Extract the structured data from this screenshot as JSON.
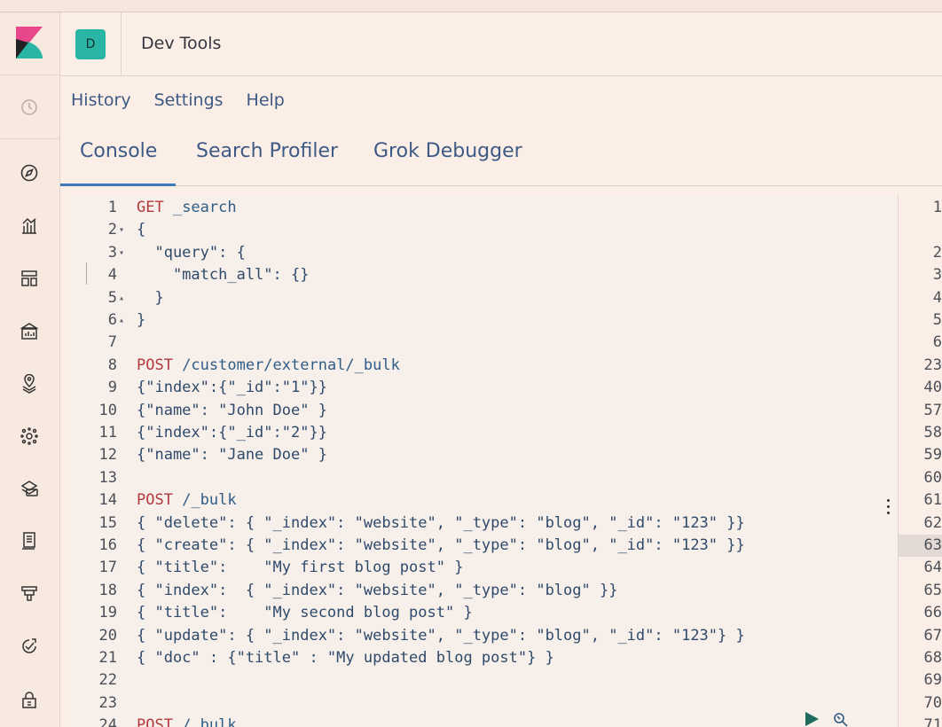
{
  "header": {
    "avatar_letter": "D",
    "title": "Dev Tools"
  },
  "nav_icons": [
    "clock-icon",
    "compass-icon",
    "visualize-icon",
    "dashboard-icon",
    "canvas-icon",
    "maps-icon",
    "ml-icon",
    "infrastructure-icon",
    "logs-icon",
    "apm-icon",
    "uptime-icon",
    "siem-icon"
  ],
  "menu": [
    "History",
    "Settings",
    "Help"
  ],
  "tabs": [
    "Console",
    "Search Profiler",
    "Grok Debugger"
  ],
  "editor": {
    "lines": [
      {
        "n": "1",
        "fold": "",
        "method": "GET",
        "rest": " _search"
      },
      {
        "n": "2",
        "fold": "▾",
        "method": "",
        "rest": "{"
      },
      {
        "n": "3",
        "fold": "▾",
        "method": "",
        "rest": "  \"query\": {"
      },
      {
        "n": "4",
        "fold": "",
        "method": "",
        "rest": "    \"match_all\": {}"
      },
      {
        "n": "5",
        "fold": "▴",
        "method": "",
        "rest": "  }"
      },
      {
        "n": "6",
        "fold": "▴",
        "method": "",
        "rest": "}"
      },
      {
        "n": "7",
        "fold": "",
        "method": "",
        "rest": ""
      },
      {
        "n": "8",
        "fold": "",
        "method": "POST",
        "rest": " /customer/external/_bulk"
      },
      {
        "n": "9",
        "fold": "",
        "method": "",
        "rest": "{\"index\":{\"_id\":\"1\"}}"
      },
      {
        "n": "10",
        "fold": "",
        "method": "",
        "rest": "{\"name\": \"John Doe\" }"
      },
      {
        "n": "11",
        "fold": "",
        "method": "",
        "rest": "{\"index\":{\"_id\":\"2\"}}"
      },
      {
        "n": "12",
        "fold": "",
        "method": "",
        "rest": "{\"name\": \"Jane Doe\" }"
      },
      {
        "n": "13",
        "fold": "",
        "method": "",
        "rest": ""
      },
      {
        "n": "14",
        "fold": "",
        "method": "POST",
        "rest": " /_bulk"
      },
      {
        "n": "15",
        "fold": "",
        "method": "",
        "rest": "{ \"delete\": { \"_index\": \"website\", \"_type\": \"blog\", \"_id\": \"123\" }}"
      },
      {
        "n": "16",
        "fold": "",
        "method": "",
        "rest": "{ \"create\": { \"_index\": \"website\", \"_type\": \"blog\", \"_id\": \"123\" }}"
      },
      {
        "n": "17",
        "fold": "",
        "method": "",
        "rest": "{ \"title\":    \"My first blog post\" }"
      },
      {
        "n": "18",
        "fold": "",
        "method": "",
        "rest": "{ \"index\":  { \"_index\": \"website\", \"_type\": \"blog\" }}"
      },
      {
        "n": "19",
        "fold": "",
        "method": "",
        "rest": "{ \"title\":    \"My second blog post\" }"
      },
      {
        "n": "20",
        "fold": "",
        "method": "",
        "rest": "{ \"update\": { \"_index\": \"website\", \"_type\": \"blog\", \"_id\": \"123\"} }"
      },
      {
        "n": "21",
        "fold": "",
        "method": "",
        "rest": "{ \"doc\" : {\"title\" : \"My updated blog post\"} }"
      },
      {
        "n": "22",
        "fold": "",
        "method": "",
        "rest": ""
      },
      {
        "n": "23",
        "fold": "",
        "method": "",
        "rest": ""
      },
      {
        "n": "24",
        "fold": "",
        "method": "POST",
        "rest": " /_bulk"
      }
    ]
  },
  "output_gutter": [
    "1",
    "",
    "2",
    "3",
    "4",
    "5",
    "6",
    "23",
    "40",
    "57",
    "58",
    "59",
    "60",
    "61",
    "62",
    "63",
    "64",
    "65",
    "66",
    "67",
    "68",
    "69",
    "70",
    "71"
  ],
  "colors": {
    "accent": "#3c7ab7",
    "method": "#b4393c",
    "avatar": "#2bb5a4",
    "link": "#3c5a85"
  }
}
